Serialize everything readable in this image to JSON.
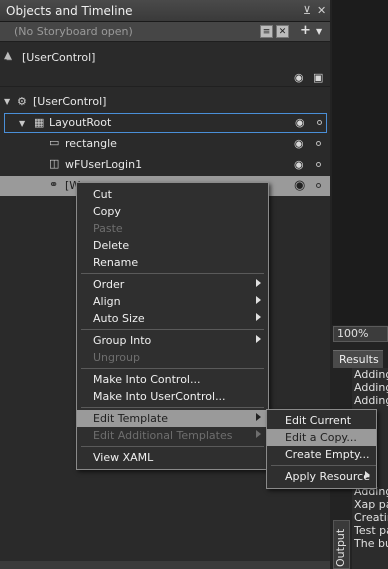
{
  "panel": {
    "title": "Objects and Timeline",
    "pin_icon": "pin-icon",
    "close_icon": "close-icon",
    "storyboard": "(No Storyboard open)",
    "scope_label": "[UserControl]"
  },
  "tree": {
    "root": "[UserControl]",
    "layout_root": "LayoutRoot",
    "rectangle": "rectangle",
    "login": "wFUserLogin1",
    "selected_partial": "[W"
  },
  "context_menu": {
    "cut": "Cut",
    "copy": "Copy",
    "paste": "Paste",
    "delete": "Delete",
    "rename": "Rename",
    "order": "Order",
    "align": "Align",
    "auto_size": "Auto Size",
    "group_into": "Group Into",
    "ungroup": "Ungroup",
    "make_control": "Make Into Control...",
    "make_usercontrol": "Make Into UserControl...",
    "edit_template": "Edit Template",
    "edit_additional": "Edit Additional Templates",
    "view_xaml": "View XAML"
  },
  "submenu": {
    "edit_current": "Edit Current",
    "edit_copy": "Edit a Copy...",
    "create_empty": "Create Empty...",
    "apply_resource": "Apply Resource"
  },
  "right": {
    "zoom": "100%",
    "results_tab": "Results",
    "results_lines": [
      "Adding",
      "Adding",
      "Adding",
      "Adding",
      "Xap pa",
      "Creatin",
      "Test pa",
      "The bu"
    ],
    "output_tab": "Output"
  }
}
